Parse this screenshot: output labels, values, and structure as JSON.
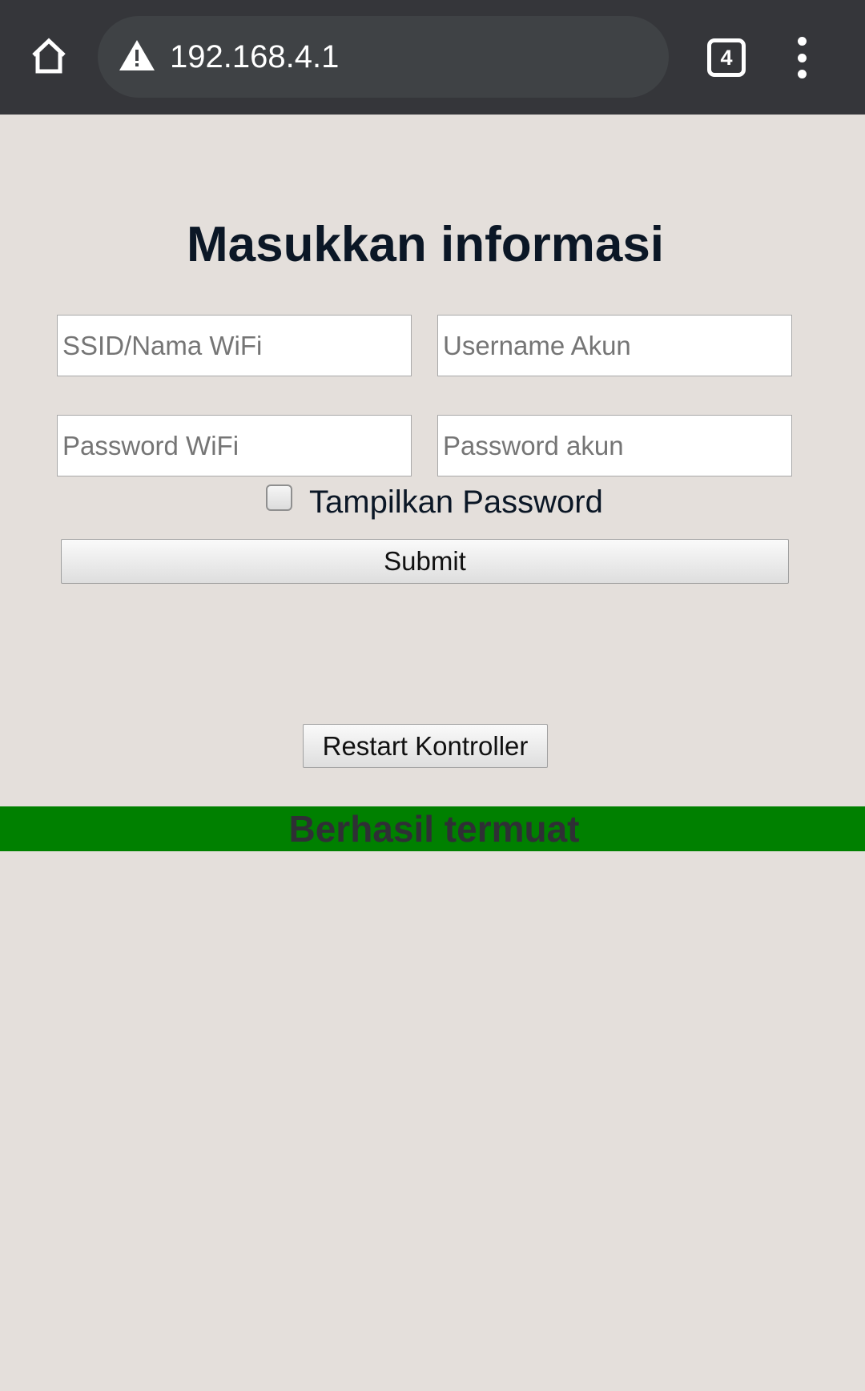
{
  "browser": {
    "url": "192.168.4.1",
    "tab_count": "4",
    "icons": {
      "home": "home-icon",
      "security": "warning-icon",
      "tabs": "tab-switcher-icon",
      "menu": "more-vert-icon"
    }
  },
  "page": {
    "title": "Masukkan informasi",
    "fields": {
      "ssid_placeholder": "SSID/Nama WiFi",
      "username_placeholder": "Username Akun",
      "wifi_password_placeholder": "Password WiFi",
      "account_password_placeholder": "Password akun"
    },
    "show_password_label": "Tampilkan Password",
    "show_password_checked": false,
    "submit_label": "Submit",
    "restart_label": "Restart Kontroller",
    "status_text": "Berhasil termuat"
  },
  "colors": {
    "browser_bar": "#35363a",
    "omnibox": "#3f4245",
    "page_background": "#e4dfdb",
    "title_text": "#0b1726",
    "status_bar": "#008000",
    "status_text": "#2f2f35"
  }
}
